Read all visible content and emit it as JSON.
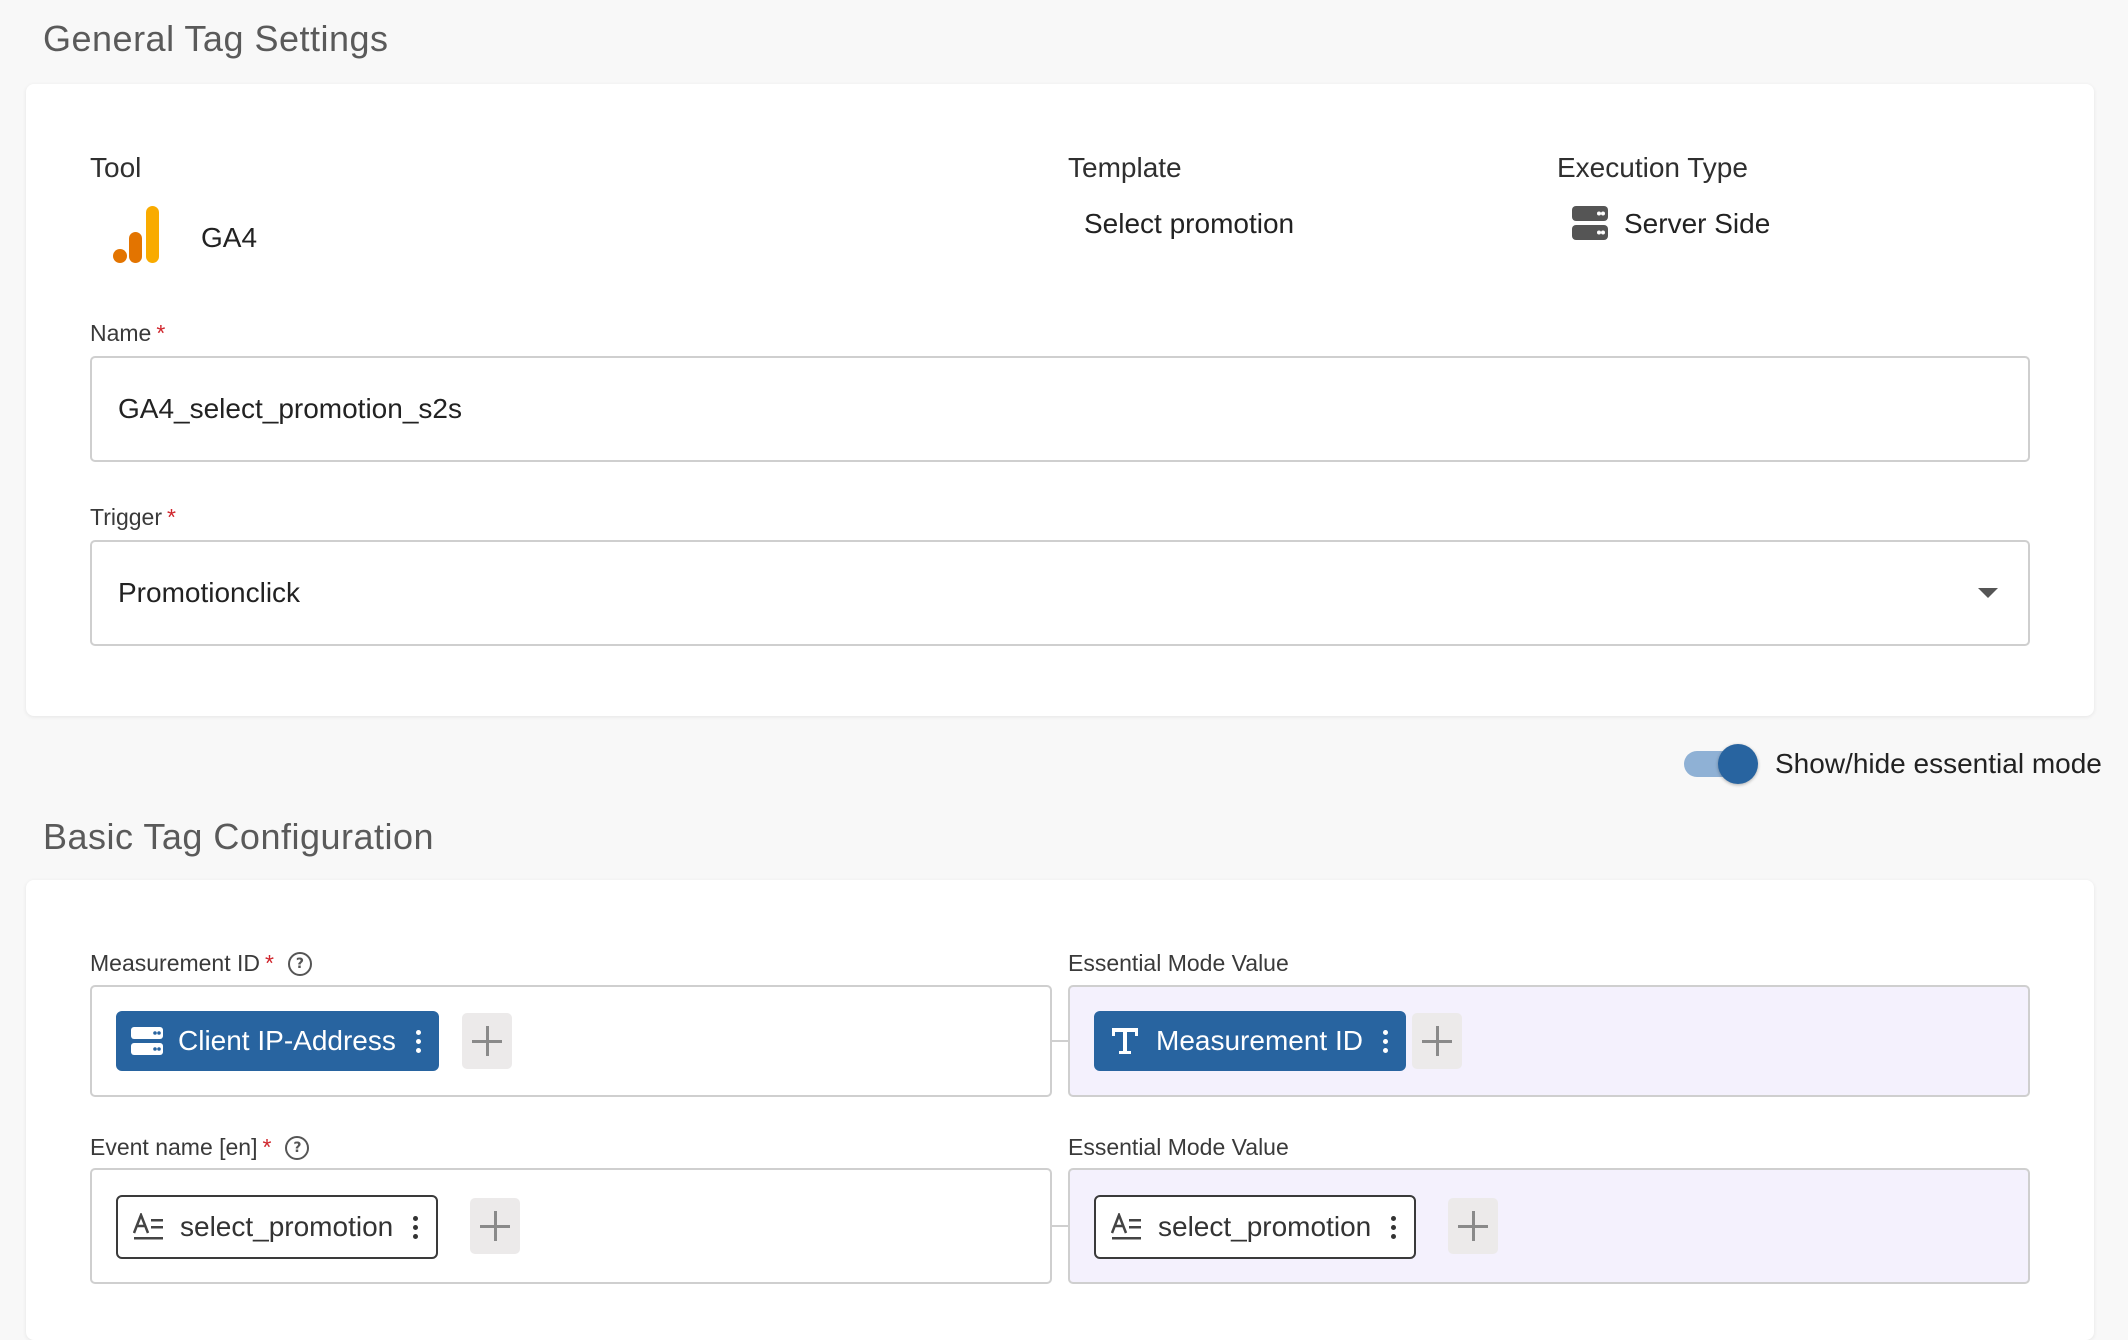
{
  "general": {
    "title": "General Tag Settings",
    "tool_label": "Tool",
    "tool_value": "GA4",
    "template_label": "Template",
    "template_value": "Select promotion",
    "execution_label": "Execution Type",
    "execution_value": "Server Side",
    "name_label": "Name",
    "name_value": "GA4_select_promotion_s2s",
    "trigger_label": "Trigger",
    "trigger_value": "Promotionclick",
    "required_mark": "*"
  },
  "toggle": {
    "label": "Show/hide essential mode",
    "on": true
  },
  "basic": {
    "title": "Basic Tag Configuration",
    "rows": [
      {
        "label": "Measurement ID",
        "chip_label": "Client IP-Address",
        "chip_icon": "server-icon",
        "essential_label": "Essential Mode Value",
        "essential_chip_label": "Measurement ID",
        "essential_chip_icon": "text-icon"
      },
      {
        "label": "Event name [en]",
        "chip_label": "select_promotion",
        "chip_icon": "text-format-icon",
        "essential_label": "Essential Mode Value",
        "essential_chip_label": "select_promotion",
        "essential_chip_icon": "text-format-icon"
      }
    ]
  },
  "colors": {
    "accent": "#2864a0",
    "ga4_orange": "#f4b400",
    "ga4_dark_orange": "#e37400",
    "essential_bg": "#f4f1fd",
    "required": "#d0262d"
  }
}
